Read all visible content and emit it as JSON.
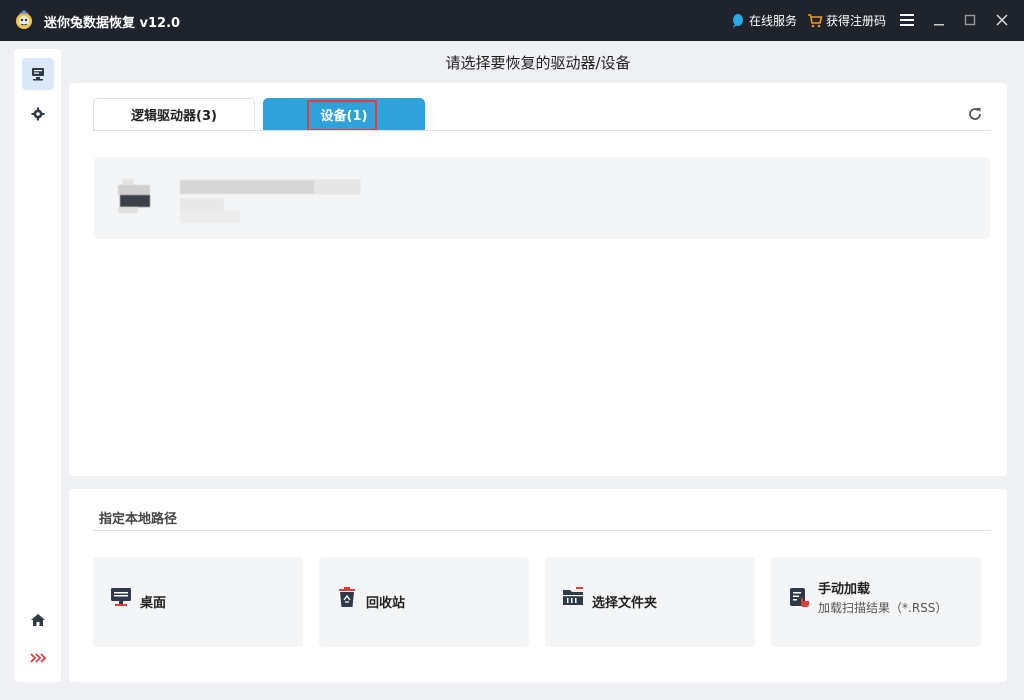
{
  "window": {
    "title": "迷你兔数据恢复 v12.0",
    "service_label": "在线服务",
    "register_label": "获得注册码",
    "icons": {
      "logo": "app-logo-icon",
      "service": "chat-bubble-icon",
      "register": "cart-icon",
      "menu": "hamburger-menu-icon",
      "minimize": "minimize-icon",
      "maximize": "maximize-icon",
      "close": "close-icon"
    }
  },
  "sidebar": {
    "items": [
      {
        "icon": "drive-icon",
        "active": true
      },
      {
        "icon": "gear-icon",
        "active": false
      },
      {
        "icon": "home-icon",
        "active": false
      },
      {
        "icon": "expand-chevron-icon",
        "active": false
      }
    ]
  },
  "main": {
    "heading": "请选择要恢复的驱动器/设备",
    "tabs": [
      {
        "label": "逻辑驱动器(3)",
        "active": false
      },
      {
        "label": "设备(1)",
        "active": true
      }
    ],
    "refresh_icon": "refresh-icon",
    "accent_color": "#2ea2d9",
    "highlight_color": "#e5393a"
  },
  "local_path": {
    "title": "指定本地路径",
    "cards": [
      {
        "label": "桌面",
        "icon": "desktop-monitor-icon"
      },
      {
        "label": "回收站",
        "icon": "recycle-bin-icon"
      },
      {
        "label": "选择文件夹",
        "icon": "folder-icon"
      },
      {
        "label": "手动加载",
        "sub": "加载扫描结果（*.RSS）",
        "icon": "manual-load-icon"
      }
    ]
  }
}
